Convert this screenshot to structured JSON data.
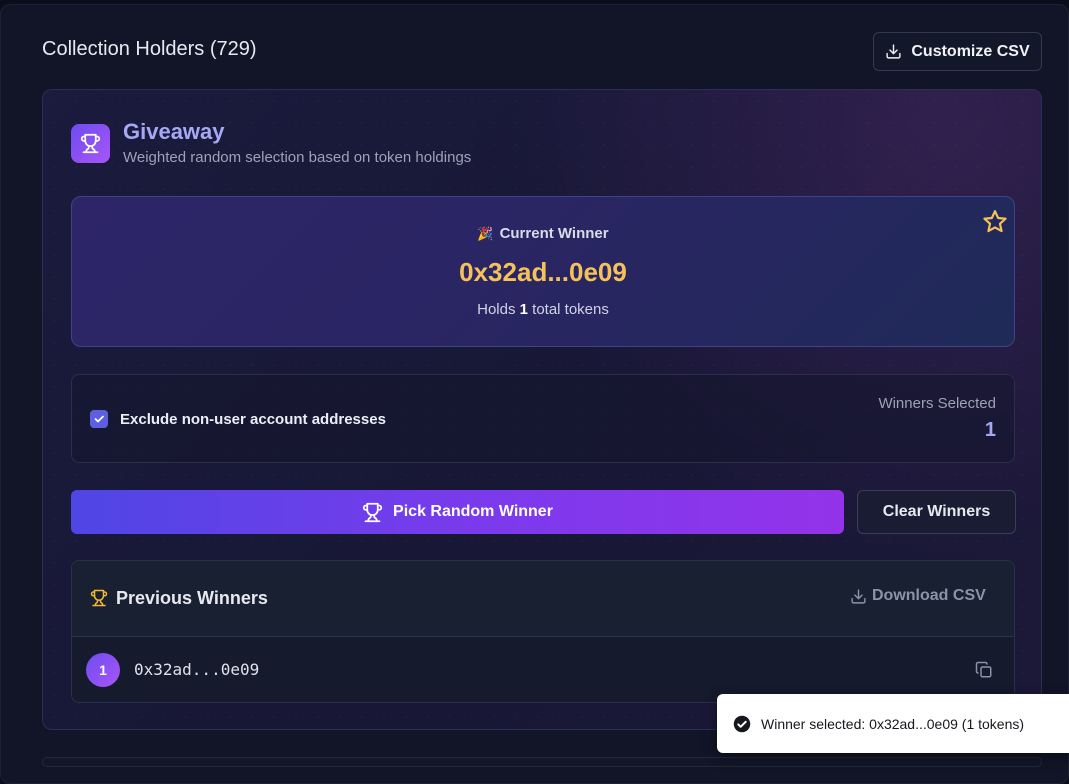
{
  "header": {
    "title": "Collection Holders (729)",
    "customize_csv_label": "Customize CSV"
  },
  "giveaway": {
    "title": "Giveaway",
    "subtitle": "Weighted random selection based on token holdings",
    "current_winner": {
      "label": "Current Winner",
      "emoji": "🎉",
      "address": "0x32ad...0e09",
      "holds_prefix": "Holds",
      "holds_count": "1",
      "holds_suffix": "total tokens"
    },
    "options": {
      "exclude_label": "Exclude non-user account addresses",
      "exclude_checked": true,
      "winners_selected_label": "Winners Selected",
      "winners_selected_count": "1"
    },
    "pick_button_label": "Pick Random Winner",
    "clear_button_label": "Clear Winners",
    "previous_winners": {
      "title": "Previous Winners",
      "download_label": "Download CSV",
      "rows": [
        {
          "index": "1",
          "address": "0x32ad...0e09"
        }
      ]
    }
  },
  "toast": {
    "message": "Winner selected: 0x32ad...0e09 (1 tokens)",
    "icon": "check-circle-icon"
  },
  "colors": {
    "accent": "#6d4cf0",
    "winner_gold": "#f5c15a",
    "title_lavender": "#a5a8f5"
  }
}
